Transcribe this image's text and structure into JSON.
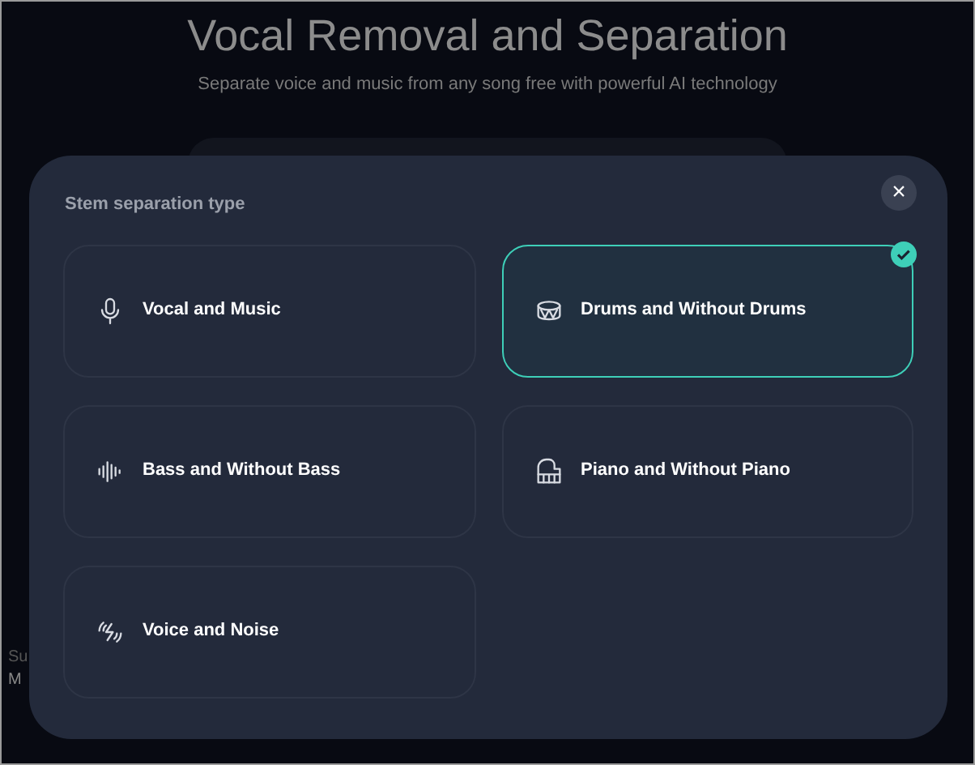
{
  "page": {
    "title": "Vocal Removal and Separation",
    "subtitle": "Separate voice and music from any song free with powerful AI technology",
    "side_texts": [
      "Su",
      "M"
    ]
  },
  "dialog": {
    "title": "Stem separation type",
    "close": "×",
    "options": [
      {
        "kind": "microphone",
        "label": "Vocal and Music",
        "selected": false
      },
      {
        "kind": "drum",
        "label": "Drums and Without Drums",
        "selected": true
      },
      {
        "kind": "wave",
        "label": "Bass and Without Bass",
        "selected": false
      },
      {
        "kind": "piano",
        "label": "Piano and Without Piano",
        "selected": false
      },
      {
        "kind": "noise",
        "label": "Voice and Noise",
        "selected": false
      }
    ]
  }
}
